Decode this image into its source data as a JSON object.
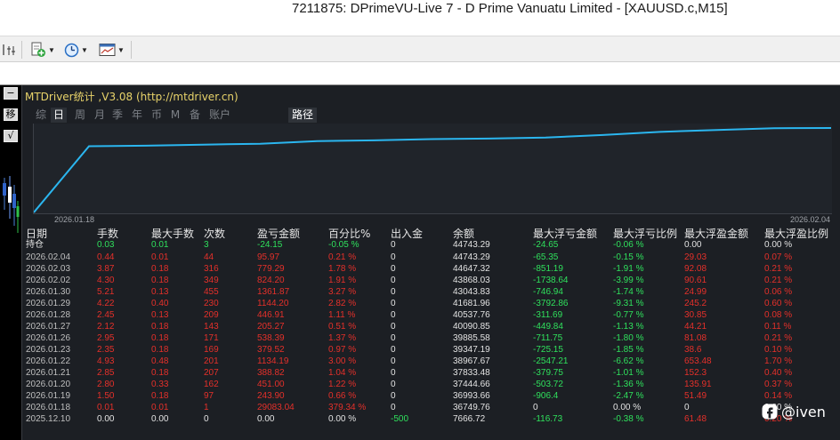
{
  "window": {
    "title": "7211875: DPrimeVU-Live 7 - D Prime Vanuatu Limited - [XAUUSD.c,M15]"
  },
  "toolbar": {
    "icons": [
      "period-separator-icon",
      "add-indicator-icon",
      "clock-icon",
      "templates-icon"
    ]
  },
  "sidebar": {
    "buttons": [
      {
        "icon": "minimize-icon",
        "label": "−"
      },
      {
        "icon": "move-icon",
        "label": "移"
      },
      {
        "icon": "check-icon",
        "label": "√"
      }
    ]
  },
  "panel": {
    "title": "MTDriver统计 ,V3.08 (http://mtdriver.cn)",
    "tabs": [
      "综",
      "日",
      "周",
      "月",
      "季",
      "年",
      "币",
      "M",
      "备",
      "账户"
    ],
    "active_tab": "日",
    "path_button": "路径",
    "colors": {
      "line": "#2bb6ef",
      "loss": "#e5302a",
      "profit": "#2fe05c",
      "background": "#1c1f24"
    }
  },
  "chart_data": {
    "type": "line",
    "x_start_label": "2026.01.18",
    "x_end_label": "2026.02.04",
    "x": [
      "2025.12.10",
      "2026.01.18",
      "2026.01.19",
      "2026.01.20",
      "2026.01.21",
      "2026.01.22",
      "2026.01.23",
      "2026.01.26",
      "2026.01.27",
      "2026.01.28",
      "2026.01.29",
      "2026.01.30",
      "2026.02.02",
      "2026.02.03",
      "2026.02.04"
    ],
    "values": [
      7666.72,
      36749.76,
      36993.66,
      37444.66,
      37833.48,
      38967.67,
      39347.19,
      39885.58,
      40090.85,
      40537.76,
      41681.96,
      43043.83,
      43868.03,
      44647.32,
      44743.29
    ],
    "ylim": [
      7666.72,
      44743.29
    ]
  },
  "table": {
    "headers": [
      "日期",
      "手数",
      "最大手数",
      "次数",
      "盈亏金额",
      "百分比%",
      "出入金",
      "余额",
      "最大浮亏金额",
      "最大浮亏比例",
      "最大浮盈金额",
      "最大浮盈比例"
    ],
    "holding": {
      "label": "持仓",
      "cells": [
        "0.03",
        "0.01",
        "3",
        "-24.15",
        "-0.05 %",
        "0",
        "44743.29",
        "-24.65",
        "-0.06 %",
        "0.00",
        "0.00 %"
      ]
    },
    "rows": [
      [
        "2026.02.04",
        "0.44",
        "0.01",
        "44",
        "95.97",
        "0.21 %",
        "0",
        "44743.29",
        "-65.35",
        "-0.15 %",
        "29.03",
        "0.07 %"
      ],
      [
        "2026.02.03",
        "3.87",
        "0.18",
        "316",
        "779.29",
        "1.78 %",
        "0",
        "44647.32",
        "-851.19",
        "-1.91 %",
        "92.08",
        "0.21 %"
      ],
      [
        "2026.02.02",
        "4.30",
        "0.18",
        "349",
        "824.20",
        "1.91 %",
        "0",
        "43868.03",
        "-1738.64",
        "-3.99 %",
        "90.61",
        "0.21 %"
      ],
      [
        "2026.01.30",
        "5.21",
        "0.13",
        "455",
        "1361.87",
        "3.27 %",
        "0",
        "43043.83",
        "-746.94",
        "-1.74 %",
        "24.99",
        "0.06 %"
      ],
      [
        "2026.01.29",
        "4.22",
        "0.40",
        "230",
        "1144.20",
        "2.82 %",
        "0",
        "41681.96",
        "-3792.86",
        "-9.31 %",
        "245.2",
        "0.60 %"
      ],
      [
        "2026.01.28",
        "2.45",
        "0.13",
        "209",
        "446.91",
        "1.11 %",
        "0",
        "40537.76",
        "-311.69",
        "-0.77 %",
        "30.85",
        "0.08 %"
      ],
      [
        "2026.01.27",
        "2.12",
        "0.18",
        "143",
        "205.27",
        "0.51 %",
        "0",
        "40090.85",
        "-449.84",
        "-1.13 %",
        "44.21",
        "0.11 %"
      ],
      [
        "2026.01.26",
        "2.95",
        "0.18",
        "171",
        "538.39",
        "1.37 %",
        "0",
        "39885.58",
        "-711.75",
        "-1.80 %",
        "81.08",
        "0.21 %"
      ],
      [
        "2026.01.23",
        "2.35",
        "0.18",
        "169",
        "379.52",
        "0.97 %",
        "0",
        "39347.19",
        "-725.15",
        "-1.85 %",
        "38.6",
        "0.10 %"
      ],
      [
        "2026.01.22",
        "4.93",
        "0.48",
        "201",
        "1134.19",
        "3.00 %",
        "0",
        "38967.67",
        "-2547.21",
        "-6.62 %",
        "653.48",
        "1.70 %"
      ],
      [
        "2026.01.21",
        "2.85",
        "0.18",
        "207",
        "388.82",
        "1.04 %",
        "0",
        "37833.48",
        "-379.75",
        "-1.01 %",
        "152.3",
        "0.40 %"
      ],
      [
        "2026.01.20",
        "2.80",
        "0.33",
        "162",
        "451.00",
        "1.22 %",
        "0",
        "37444.66",
        "-503.72",
        "-1.36 %",
        "135.91",
        "0.37 %"
      ],
      [
        "2026.01.19",
        "1.50",
        "0.18",
        "97",
        "243.90",
        "0.66 %",
        "0",
        "36993.66",
        "-906.4",
        "-2.47 %",
        "51.49",
        "0.14 %"
      ],
      [
        "2026.01.18",
        "0.01",
        "0.01",
        "1",
        "29083.04",
        "379.34 %",
        "0",
        "36749.76",
        "0",
        "0.00 %",
        "0",
        "0.00 %"
      ],
      [
        "2025.12.10",
        "0.00",
        "0.00",
        "0",
        "0.00",
        "0.00 %",
        "-500",
        "7666.72",
        "-116.73",
        "-0.38 %",
        "61.48",
        "0.20 %"
      ]
    ]
  },
  "watermark": {
    "text": "@iven",
    "icon": "social-logo-icon"
  }
}
